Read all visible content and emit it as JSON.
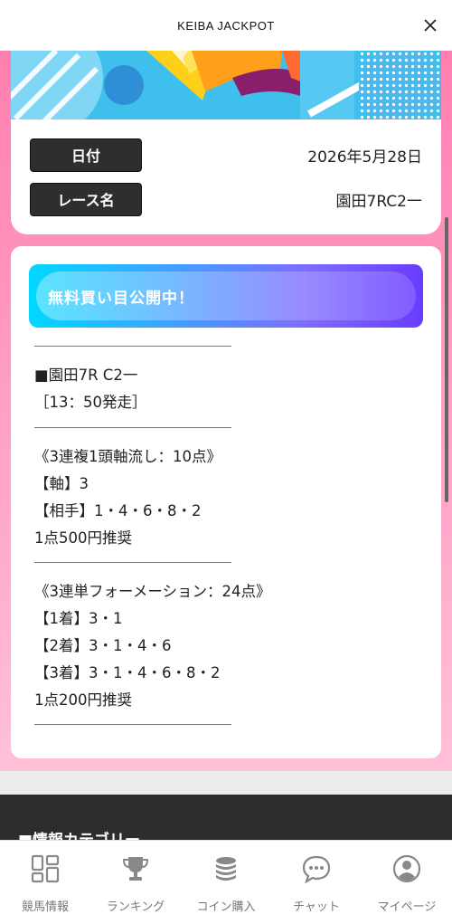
{
  "header": {
    "title": "KEIBA JACKPOT",
    "close_icon": "close-icon"
  },
  "race_info": {
    "date_label": "日付",
    "date_value": "2026年5月28日",
    "race_label": "レース名",
    "race_value": "園田7RC2一"
  },
  "tips": {
    "banner_text": "無料買い目公開中！",
    "race_line": "■園田7R C2一",
    "start_line": "［13：50発走］",
    "bet1": {
      "title": "《3連複1頭軸流し：10点》",
      "axis": "【軸】3",
      "partners": "【相手】1・4・6・8・2",
      "stake": "1点500円推奨"
    },
    "bet2": {
      "title": "《3連単フォーメーション：24点》",
      "first": "【1着】3・1",
      "second": "【2着】3・1・4・6",
      "third": "【3着】3・1・4・6・8・2",
      "stake": "1点200円推奨"
    }
  },
  "category_heading": "■情報カテゴリー",
  "bottom_nav": [
    {
      "label": "競馬情報",
      "icon": "grid-icon"
    },
    {
      "label": "ランキング",
      "icon": "trophy-icon"
    },
    {
      "label": "コイン購入",
      "icon": "coins-icon"
    },
    {
      "label": "チャット",
      "icon": "chat-bubble-icon"
    },
    {
      "label": "マイページ",
      "icon": "user-icon"
    }
  ],
  "colors": {
    "accent_pink": "#ff7eb0",
    "banner_cyan": "#00d8ff",
    "banner_purple": "#6a3cff",
    "label_dark": "#2e2e2e"
  }
}
